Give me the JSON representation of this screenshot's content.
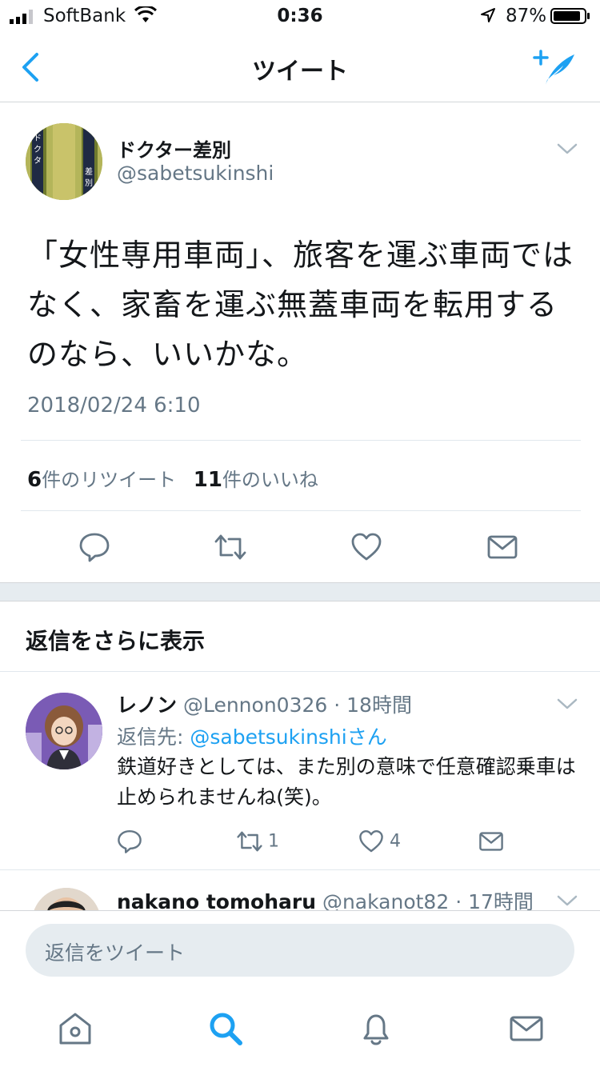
{
  "status_bar": {
    "carrier": "SoftBank",
    "time": "0:36",
    "battery_percent": "87%"
  },
  "nav": {
    "title": "ツイート"
  },
  "tweet": {
    "author_name": "ドクター差別",
    "author_handle": "@sabetsukinshi",
    "avatar_text": "ドクター差別",
    "text": "「女性専用車両」、旅客を運ぶ車両ではなく、家畜を運ぶ無蓋車両を転用するのなら、いいかな。",
    "timestamp": "2018/02/24 6:10",
    "retweet_count": "6",
    "retweet_label": "件のリツイート",
    "like_count": "11",
    "like_label": "件のいいね"
  },
  "more_replies_label": "返信をさらに表示",
  "replies": [
    {
      "name": "レノン",
      "handle": "@Lennon0326",
      "age": "· 18時間",
      "reply_to_prefix": "返信先: ",
      "reply_to_handle": "@sabetsukinshiさん",
      "text": "鉄道好きとしては、また別の意味で任意確認乗車は止められませんね(笑)。",
      "retweet_count": "1",
      "like_count": "4"
    },
    {
      "name": "nakano tomoharu",
      "handle": "@nakanot82",
      "age": "· 17時間"
    }
  ],
  "composer": {
    "placeholder": "返信をツイート"
  },
  "colors": {
    "accent": "#1da1f2",
    "secondary_text": "#657786",
    "divider": "#e1e8ed"
  },
  "icons": [
    "back-chevron-icon",
    "compose-tweet-icon",
    "reply-icon",
    "retweet-icon",
    "like-icon",
    "direct-message-icon",
    "home-icon",
    "search-icon",
    "notifications-icon",
    "messages-icon"
  ]
}
